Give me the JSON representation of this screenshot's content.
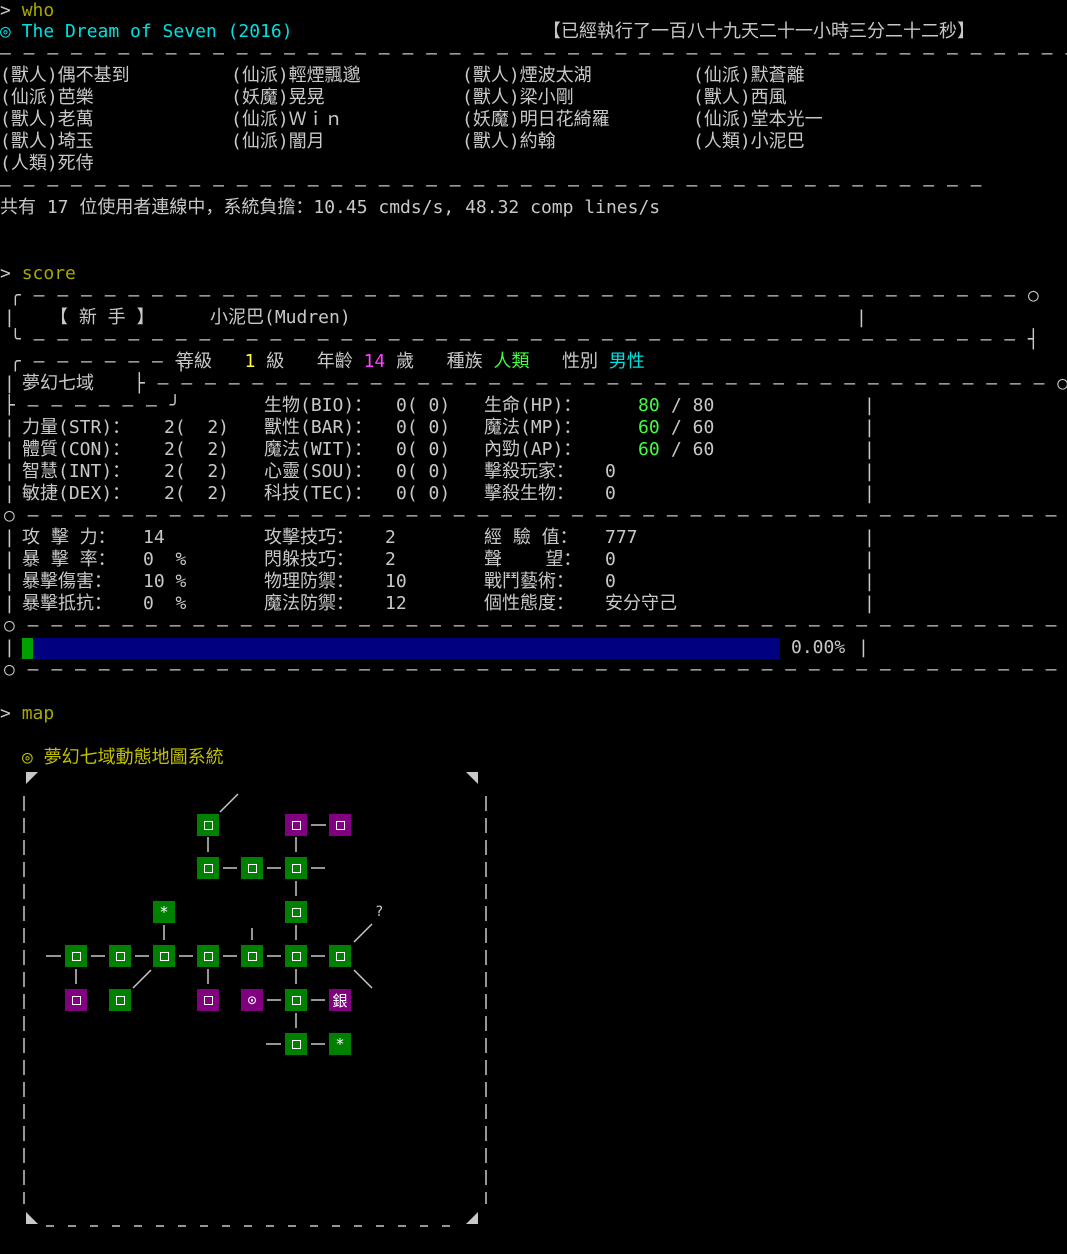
{
  "who": {
    "prompt": ">",
    "command": "who",
    "mud_title": "◎ The Dream of Seven (2016)",
    "uptime": "【已經執行了一百八十九天二十一小時三分二十二秒】",
    "users": [
      "(獸人)偶不基到",
      "(仙派)輕煙飄邈",
      "(獸人)煙波太湖",
      "(仙派)默蒼離",
      "(仙派)芭樂",
      "(妖魔)晃晃",
      "(獸人)梁小剛",
      "(獸人)西風",
      "(獸人)老萬",
      "(仙派)Ｗｉｎ",
      "(妖魔)明日花綺羅",
      "(仙派)堂本光一",
      "(獸人)埼玉",
      "(仙派)闇月",
      "(獸人)約翰",
      "(人類)小泥巴",
      "(人類)死侍"
    ],
    "summary_prefix": "共有 ",
    "summary_count": "17",
    "summary_rest": " 位使用者連線中，系統負擔：10.45 cmds/s, 48.32 comp lines/s"
  },
  "score": {
    "prompt": ">",
    "command": "score",
    "rank": "【 新 手 】",
    "name": "小泥巴(Mudren)",
    "realm": "夢幻七域",
    "level_label": "等級",
    "level": "1",
    "level_unit": "級",
    "age_label": "年齡",
    "age": "14",
    "age_unit": "歲",
    "race_label": "種族",
    "race": "人類",
    "gender_label": "性別",
    "gender": "男性",
    "stats_left": [
      {
        "label": "力量(STR)：",
        "value": "2(  2)"
      },
      {
        "label": "體質(CON)：",
        "value": "2(  2)"
      },
      {
        "label": "智慧(INT)：",
        "value": "2(  2)"
      },
      {
        "label": "敏捷(DEX)：",
        "value": "2(  2)"
      }
    ],
    "stats_mid": [
      {
        "label": "生物(BIO)：",
        "value": "0( 0)"
      },
      {
        "label": "獸性(BAR)：",
        "value": "0( 0)"
      },
      {
        "label": "魔法(WIT)：",
        "value": "0( 0)"
      },
      {
        "label": "心靈(SOU)：",
        "value": "0( 0)"
      },
      {
        "label": "科技(TEC)：",
        "value": "0( 0)"
      }
    ],
    "vitals": [
      {
        "label": "生命(HP)：",
        "cur": "80",
        "max": "/ 80"
      },
      {
        "label": "魔法(MP)：",
        "cur": "60",
        "max": "/ 60"
      },
      {
        "label": "內勁(AP)：",
        "cur": "60",
        "max": "/ 60"
      }
    ],
    "kills": [
      {
        "label": "擊殺玩家：",
        "value": "0"
      },
      {
        "label": "擊殺生物：",
        "value": "0"
      }
    ],
    "combat_left": [
      {
        "label": "攻 擊 力：",
        "value": "14"
      },
      {
        "label": "暴 擊 率：",
        "value": "0  %"
      },
      {
        "label": "暴擊傷害：",
        "value": "10 %"
      },
      {
        "label": "暴擊抵抗：",
        "value": "0  %"
      }
    ],
    "combat_mid": [
      {
        "label": "攻擊技巧：",
        "value": "2"
      },
      {
        "label": "閃躲技巧：",
        "value": "2"
      },
      {
        "label": "物理防禦：",
        "value": "10"
      },
      {
        "label": "魔法防禦：",
        "value": "12"
      }
    ],
    "combat_right": [
      {
        "label": "經 驗 值：",
        "value": "777"
      },
      {
        "label": "聲    望：",
        "value": "0"
      },
      {
        "label": "戰鬥藝術：",
        "value": "0"
      },
      {
        "label": "個性態度：",
        "value": "安分守己"
      }
    ],
    "progress_text": "0.00%",
    "progress_fraction": 0.0
  },
  "map": {
    "prompt": ">",
    "command": "map",
    "title": "◎ 夢幻七域動態地圖系統",
    "star": "*",
    "target": "⊙",
    "bank": "銀",
    "unknown": "?"
  },
  "colors": {
    "background": "#000000",
    "room_green": "#008000",
    "room_purple": "#800080",
    "progress_bar": "#000080",
    "progress_fill": "#00a000"
  }
}
